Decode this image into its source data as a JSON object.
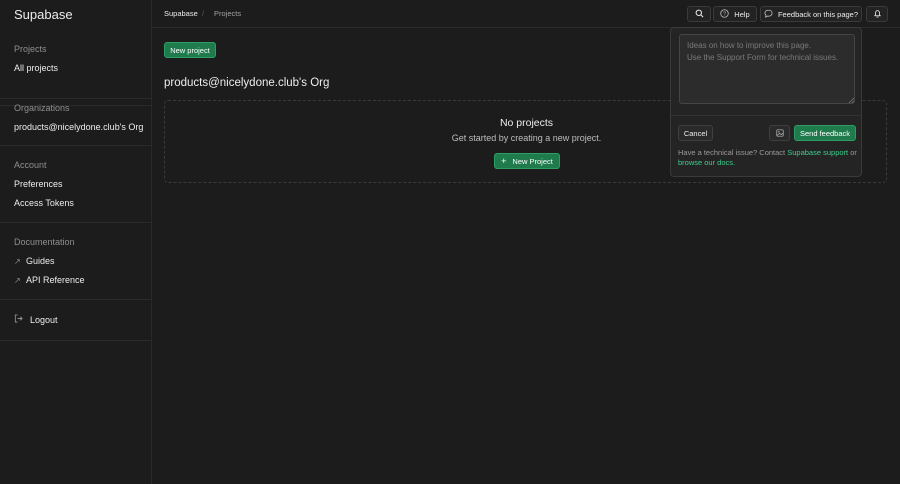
{
  "brand": "Supabase",
  "breadcrumb": {
    "org": "Supabase",
    "separator": "/",
    "page": "Projects"
  },
  "sidebar": {
    "projects": {
      "heading": "Projects",
      "items": [
        "All projects"
      ]
    },
    "organizations": {
      "heading": "Organizations",
      "items": [
        "products@nicelydone.club's Org"
      ]
    },
    "account": {
      "heading": "Account",
      "items": [
        "Preferences",
        "Access Tokens"
      ]
    },
    "documentation": {
      "heading": "Documentation",
      "items": [
        "Guides",
        "API Reference"
      ]
    },
    "logout": "Logout"
  },
  "topbar": {
    "search_icon": "search-icon",
    "help_label": "Help",
    "feedback_label": "Feedback on this page?",
    "notifications_icon": "bell-icon"
  },
  "main": {
    "new_project_button": "New project",
    "org_title": "products@nicelydone.club's Org",
    "empty_title": "No projects",
    "empty_subtitle": "Get started by creating a new project.",
    "empty_button": "New Project",
    "empty_button_icon": "+"
  },
  "feedback": {
    "placeholder": "Ideas on how to improve this page.\nUse the Support Form for technical issues.",
    "value": "",
    "cancel": "Cancel",
    "send": "Send feedback",
    "help_prefix": "Have a technical issue? Contact",
    "support_link": "Supabase support",
    "help_or": "or",
    "docs_link": "browse our docs."
  },
  "colors": {
    "background": "#1c1c1c",
    "accent": "#3ecf8e",
    "button_green": "#1f7a4c",
    "border": "#2a2a2a"
  }
}
